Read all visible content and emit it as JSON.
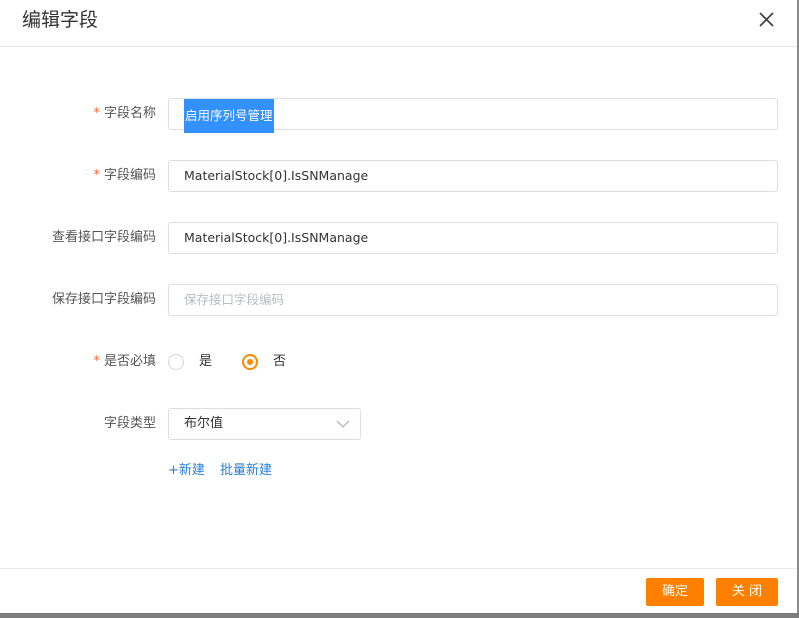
{
  "dialog": {
    "title": "编辑字段"
  },
  "form": {
    "field_name": {
      "required_mark": "*",
      "label": "字段名称",
      "value": "启用序列号管理"
    },
    "field_code": {
      "required_mark": "*",
      "label": "字段编码",
      "value": "MaterialStock[0].IsSNManage"
    },
    "query_api_code": {
      "label": "查看接口字段编码",
      "value": "MaterialStock[0].IsSNManage"
    },
    "save_api_code": {
      "label": "保存接口字段编码",
      "value": "",
      "placeholder": "保存接口字段编码"
    },
    "required": {
      "required_mark": "*",
      "label": "是否必填",
      "options": [
        "是",
        "否"
      ],
      "selected": "否"
    },
    "field_type": {
      "label": "字段类型",
      "value": "布尔值"
    },
    "actions": {
      "add_new": "+新建",
      "batch_add": "批量新建"
    }
  },
  "footer": {
    "confirm_label": "确定",
    "close_label": "关 闭"
  },
  "colors": {
    "accent": "#ff8000",
    "required_mark": "#f5672d",
    "link": "#2a7fd4",
    "selection": "#3390ff"
  },
  "icons": {
    "close": "close-icon",
    "dropdown": "chevron-down-icon"
  }
}
